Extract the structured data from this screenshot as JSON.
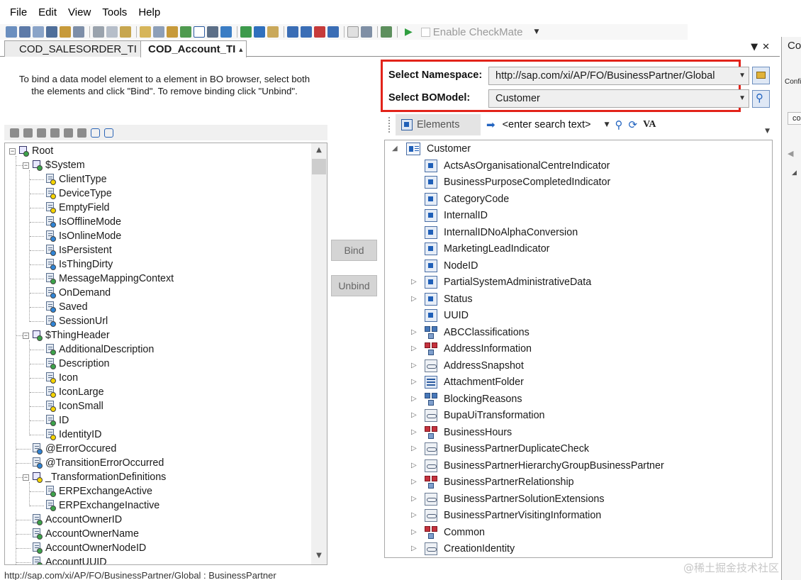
{
  "menu": [
    "File",
    "Edit",
    "View",
    "Tools",
    "Help"
  ],
  "toolbar": {
    "enable_checkmate_label": "Enable CheckMate"
  },
  "tabs": [
    {
      "label": "COD_SALESORDER_TI",
      "active": false
    },
    {
      "label": "COD_Account_TI",
      "active": true
    }
  ],
  "side_panel": {
    "title": "Co",
    "sub": "Confi",
    "item": "co"
  },
  "instructions": "To bind a data model element to a element in BO browser, select both the elements and click \"Bind\". To remove binding click \"Unbind\".",
  "buttons": {
    "bind": "Bind",
    "unbind": "Unbind"
  },
  "namespace": {
    "namespace_label": "Select Namespace:",
    "namespace_value": "http://sap.com/xi/AP/FO/BusinessPartner/Global",
    "bomodel_label": "Select BOModel:",
    "bomodel_value": "Customer"
  },
  "elements_toolbar": {
    "tab_label": "Elements",
    "search_value": "<enter search text>",
    "va_label": "VA"
  },
  "left_tree": [
    {
      "label": "Root",
      "level": 0,
      "expanded": true,
      "icon": "folder-green"
    },
    {
      "label": "$System",
      "level": 1,
      "expanded": true,
      "icon": "folder-green"
    },
    {
      "label": "ClientType",
      "level": 2,
      "dot": "y"
    },
    {
      "label": "DeviceType",
      "level": 2,
      "dot": "y"
    },
    {
      "label": "EmptyField",
      "level": 2,
      "dot": "y"
    },
    {
      "label": "IsOfflineMode",
      "level": 2,
      "dot": "b"
    },
    {
      "label": "IsOnlineMode",
      "level": 2,
      "dot": "b"
    },
    {
      "label": "IsPersistent",
      "level": 2,
      "dot": "b"
    },
    {
      "label": "IsThingDirty",
      "level": 2,
      "dot": "b"
    },
    {
      "label": "MessageMappingContext",
      "level": 2,
      "dot": "g"
    },
    {
      "label": "OnDemand",
      "level": 2,
      "dot": "b"
    },
    {
      "label": "Saved",
      "level": 2,
      "dot": "b"
    },
    {
      "label": "SessionUrl",
      "level": 2,
      "dot": "b"
    },
    {
      "label": "$ThingHeader",
      "level": 1,
      "expanded": true,
      "icon": "folder-green"
    },
    {
      "label": "AdditionalDescription",
      "level": 2,
      "dot": "g"
    },
    {
      "label": "Description",
      "level": 2,
      "dot": "g"
    },
    {
      "label": "Icon",
      "level": 2,
      "dot": "y"
    },
    {
      "label": "IconLarge",
      "level": 2,
      "dot": "y"
    },
    {
      "label": "IconSmall",
      "level": 2,
      "dot": "y"
    },
    {
      "label": "ID",
      "level": 2,
      "dot": "g"
    },
    {
      "label": "IdentityID",
      "level": 2,
      "dot": "y"
    },
    {
      "label": "@ErrorOccured",
      "level": 1,
      "dot": "b"
    },
    {
      "label": "@TransitionErrorOccurred",
      "level": 1,
      "dot": "b"
    },
    {
      "label": "_TransformationDefinitions",
      "level": 1,
      "expanded": true,
      "icon": "folder-yellow"
    },
    {
      "label": "ERPExchangeActive",
      "level": 2,
      "dot": "g"
    },
    {
      "label": "ERPExchangeInactive",
      "level": 2,
      "dot": "g"
    },
    {
      "label": "AccountOwnerID",
      "level": 1,
      "dot": "g"
    },
    {
      "label": "AccountOwnerName",
      "level": 1,
      "dot": "g"
    },
    {
      "label": "AccountOwnerNodeID",
      "level": 1,
      "dot": "g"
    },
    {
      "label": "AccountUUID",
      "level": 1,
      "dot": "g"
    }
  ],
  "right_tree": [
    {
      "label": "Customer",
      "level": 0,
      "icon": "root",
      "expanded": true
    },
    {
      "label": "ActsAsOrganisationalCentreIndicator",
      "level": 1,
      "icon": "attr"
    },
    {
      "label": "BusinessPurposeCompletedIndicator",
      "level": 1,
      "icon": "attr"
    },
    {
      "label": "CategoryCode",
      "level": 1,
      "icon": "attr"
    },
    {
      "label": "InternalID",
      "level": 1,
      "icon": "attr"
    },
    {
      "label": "InternalIDNoAlphaConversion",
      "level": 1,
      "icon": "attr"
    },
    {
      "label": "MarketingLeadIndicator",
      "level": 1,
      "icon": "attr"
    },
    {
      "label": "NodeID",
      "level": 1,
      "icon": "attr"
    },
    {
      "label": "PartialSystemAdministrativeData",
      "level": 1,
      "icon": "attr",
      "collapsed": true
    },
    {
      "label": "Status",
      "level": 1,
      "icon": "attr",
      "collapsed": true
    },
    {
      "label": "UUID",
      "level": 1,
      "icon": "attr"
    },
    {
      "label": "ABCClassifications",
      "level": 1,
      "icon": "node",
      "collapsed": true
    },
    {
      "label": "AddressInformation",
      "level": 1,
      "icon": "node-red",
      "collapsed": true
    },
    {
      "label": "AddressSnapshot",
      "level": 1,
      "icon": "assoc",
      "collapsed": true
    },
    {
      "label": "AttachmentFolder",
      "level": 1,
      "icon": "folder",
      "collapsed": true
    },
    {
      "label": "BlockingReasons",
      "level": 1,
      "icon": "node",
      "collapsed": true
    },
    {
      "label": "BupaUiTransformation",
      "level": 1,
      "icon": "assoc",
      "collapsed": true
    },
    {
      "label": "BusinessHours",
      "level": 1,
      "icon": "node-red",
      "collapsed": true
    },
    {
      "label": "BusinessPartnerDuplicateCheck",
      "level": 1,
      "icon": "assoc",
      "collapsed": true
    },
    {
      "label": "BusinessPartnerHierarchyGroupBusinessPartner",
      "level": 1,
      "icon": "assoc",
      "collapsed": true
    },
    {
      "label": "BusinessPartnerRelationship",
      "level": 1,
      "icon": "node-red",
      "collapsed": true
    },
    {
      "label": "BusinessPartnerSolutionExtensions",
      "level": 1,
      "icon": "assoc",
      "collapsed": true
    },
    {
      "label": "BusinessPartnerVisitingInformation",
      "level": 1,
      "icon": "assoc",
      "collapsed": true
    },
    {
      "label": "Common",
      "level": 1,
      "icon": "node-red",
      "collapsed": true
    },
    {
      "label": "CreationIdentity",
      "level": 1,
      "icon": "assoc",
      "collapsed": true
    }
  ],
  "statusbar": "http://sap.com/xi/AP/FO/BusinessPartner/Global : BusinessPartner",
  "watermark": "@稀土掘金技术社区",
  "colors": {
    "highlight_box": "#e2231a",
    "dot_green": "#3ca34a",
    "dot_yellow": "#f5d400",
    "dot_blue": "#2f84d6"
  }
}
